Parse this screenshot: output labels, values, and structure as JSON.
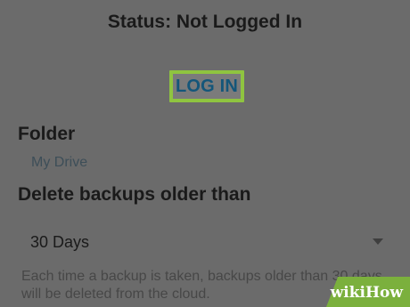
{
  "header": {
    "status_text": "Status: Not Logged In"
  },
  "login": {
    "button_label": "LOG IN",
    "highlight_color": "#8fc440"
  },
  "folder": {
    "label": "Folder",
    "value": "My Drive"
  },
  "retention": {
    "label": "Delete backups older than",
    "selected_option": "30 Days",
    "description": "Each time a backup is taken, backups older than 30 days will be deleted from the cloud."
  },
  "watermark": {
    "part1": "wiki",
    "part2": "How",
    "color": "#7bb03d"
  }
}
